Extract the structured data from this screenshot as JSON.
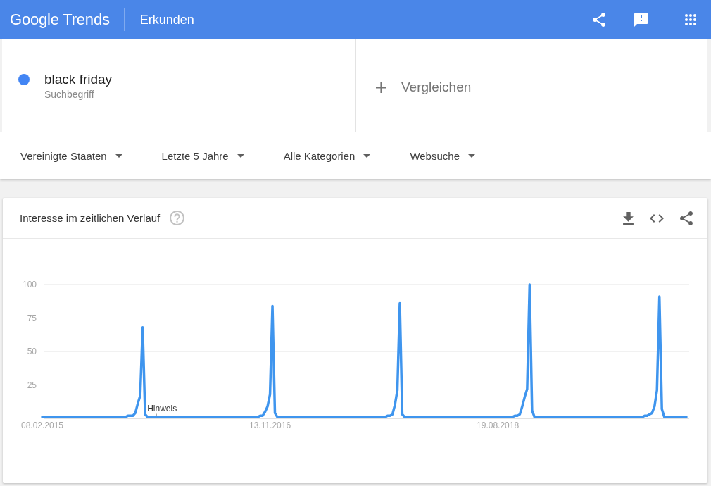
{
  "header": {
    "logo": "Google Trends",
    "title": "Erkunden"
  },
  "terms": [
    {
      "term": "black friday",
      "subtitle": "Suchbegriff",
      "color": "#4285f4"
    }
  ],
  "compare": {
    "label": "Vergleichen"
  },
  "filters": [
    {
      "label": "Vereinigte Staaten"
    },
    {
      "label": "Letzte 5 Jahre"
    },
    {
      "label": "Alle Kategorien"
    },
    {
      "label": "Websuche"
    }
  ],
  "card": {
    "title": "Interesse im zeitlichen Verlauf",
    "chart_data": {
      "type": "line",
      "categories": [
        "08.02.2015",
        null,
        null,
        null,
        null,
        null,
        null,
        null,
        null,
        null,
        null,
        null,
        null,
        null,
        null,
        null,
        null,
        null,
        null,
        null,
        null,
        null,
        null,
        null,
        null,
        null,
        null,
        null,
        null,
        null,
        null,
        null,
        null,
        null,
        null,
        null,
        null,
        null,
        null,
        null,
        null,
        null,
        null,
        null,
        null,
        null,
        null,
        null,
        null,
        null,
        null,
        null,
        null,
        null,
        null,
        null,
        null,
        null,
        null,
        null,
        null,
        null,
        null,
        null,
        null,
        null,
        null,
        null,
        null,
        null,
        null,
        null,
        null,
        null,
        null,
        null,
        null,
        null,
        null,
        null,
        null,
        null,
        null,
        null,
        null,
        null,
        null,
        null,
        null,
        null,
        null,
        null,
        null,
        "13.11.2016",
        null,
        null,
        null,
        null,
        null,
        null,
        null,
        null,
        null,
        null,
        null,
        null,
        null,
        null,
        null,
        null,
        null,
        null,
        null,
        null,
        null,
        null,
        null,
        null,
        null,
        null,
        null,
        null,
        null,
        null,
        null,
        null,
        null,
        null,
        null,
        null,
        null,
        null,
        null,
        null,
        null,
        null,
        null,
        null,
        null,
        null,
        null,
        null,
        null,
        null,
        null,
        null,
        null,
        null,
        null,
        null,
        null,
        null,
        null,
        null,
        null,
        null,
        null,
        null,
        null,
        null,
        null,
        null,
        null,
        null,
        null,
        null,
        null,
        null,
        null,
        null,
        null,
        null,
        null,
        null,
        null,
        null,
        null,
        null,
        null,
        null,
        null,
        null,
        null,
        null,
        null,
        null,
        "19.08.2018",
        null,
        null,
        null,
        null,
        null,
        null,
        null,
        null,
        null,
        null,
        null,
        null,
        null,
        null,
        null,
        null,
        null,
        null,
        null,
        null,
        null,
        null,
        null,
        null,
        null,
        null,
        null,
        null,
        null,
        null,
        null,
        null,
        null,
        null,
        null,
        null,
        null,
        null,
        null,
        null,
        null,
        null,
        null,
        null,
        null,
        null,
        null,
        null,
        null,
        null,
        null,
        null,
        null,
        null,
        null,
        null,
        null,
        null,
        null,
        null,
        null,
        null,
        null,
        null,
        null,
        null,
        null,
        null,
        null,
        null,
        null,
        null,
        null,
        null,
        null,
        null,
        null
      ],
      "series": [
        {
          "color": "#3f95ee",
          "values": [
            1,
            1,
            1,
            1,
            1,
            1,
            1,
            1,
            1,
            1,
            1,
            1,
            1,
            1,
            1,
            1,
            1,
            1,
            1,
            1,
            1,
            1,
            1,
            1,
            1,
            1,
            1,
            1,
            1,
            1,
            1,
            1,
            1,
            1,
            1,
            2,
            2,
            2,
            4,
            11,
            17,
            68,
            3,
            1,
            1,
            1,
            1,
            1,
            1,
            1,
            1,
            1,
            1,
            1,
            1,
            1,
            1,
            1,
            1,
            1,
            1,
            1,
            1,
            1,
            1,
            1,
            1,
            1,
            1,
            1,
            1,
            1,
            1,
            1,
            1,
            1,
            1,
            1,
            1,
            1,
            1,
            1,
            1,
            1,
            1,
            1,
            1,
            1,
            1,
            2,
            2,
            5,
            9,
            18,
            84,
            4,
            1,
            1,
            1,
            1,
            1,
            1,
            1,
            1,
            1,
            1,
            1,
            1,
            1,
            1,
            1,
            1,
            1,
            1,
            1,
            1,
            1,
            1,
            1,
            1,
            1,
            1,
            1,
            1,
            1,
            1,
            1,
            1,
            1,
            1,
            1,
            1,
            1,
            1,
            1,
            1,
            1,
            1,
            1,
            1,
            1,
            2,
            2,
            3,
            10,
            21,
            86,
            3,
            1,
            1,
            1,
            1,
            1,
            1,
            1,
            1,
            1,
            1,
            1,
            1,
            1,
            1,
            1,
            1,
            1,
            1,
            1,
            1,
            1,
            1,
            1,
            1,
            1,
            1,
            1,
            1,
            1,
            1,
            1,
            1,
            1,
            1,
            1,
            1,
            1,
            1,
            1,
            1,
            1,
            1,
            1,
            1,
            1,
            2,
            2,
            3,
            9,
            16,
            22,
            100,
            6,
            1,
            1,
            1,
            1,
            1,
            1,
            1,
            1,
            1,
            1,
            1,
            1,
            1,
            1,
            1,
            1,
            1,
            1,
            1,
            1,
            1,
            1,
            1,
            1,
            1,
            1,
            1,
            1,
            1,
            1,
            1,
            1,
            1,
            1,
            1,
            1,
            1,
            1,
            1,
            1,
            1,
            1,
            1,
            1,
            1,
            2,
            2,
            3,
            4,
            9,
            21,
            91,
            7,
            1,
            1,
            1,
            1,
            1,
            1,
            1,
            1,
            1,
            1
          ]
        }
      ],
      "ylim": [
        0,
        100
      ],
      "yticks": [
        25,
        50,
        75,
        100
      ],
      "grid": true,
      "annotations": [
        "Hinweis"
      ]
    }
  }
}
